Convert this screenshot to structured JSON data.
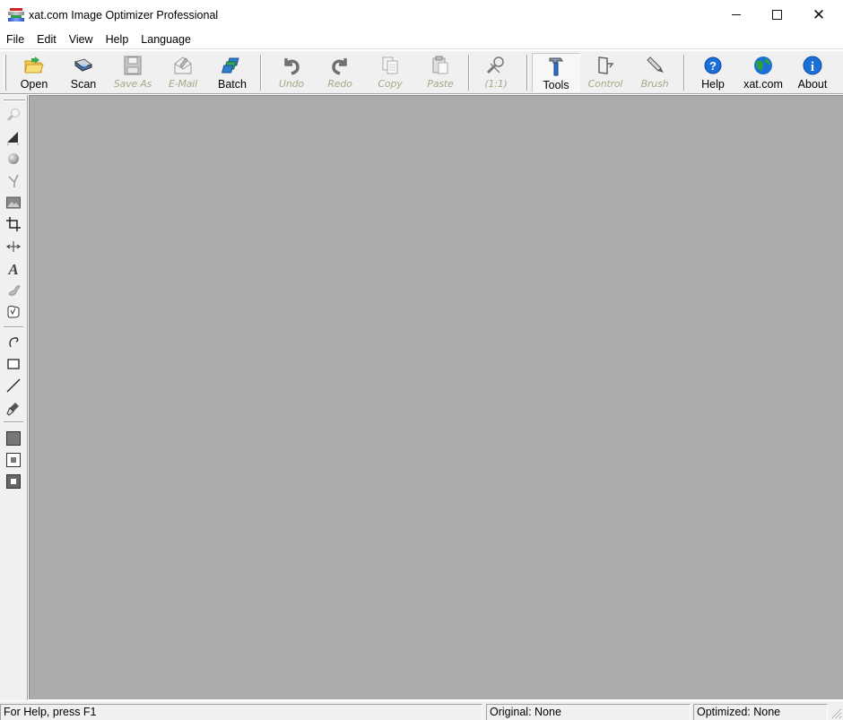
{
  "window": {
    "title": "xat.com  Image Optimizer Professional",
    "app_icon": "xat-app-icon",
    "controls": {
      "minimize": "minimize-icon",
      "maximize": "maximize-icon",
      "close": "close-icon"
    }
  },
  "menubar": {
    "items": [
      {
        "label": "File"
      },
      {
        "label": "Edit"
      },
      {
        "label": "View"
      },
      {
        "label": "Help"
      },
      {
        "label": "Language"
      }
    ]
  },
  "toolbar": {
    "buttons": [
      {
        "label": "Open",
        "icon": "folder-open-icon",
        "enabled": true
      },
      {
        "label": "Scan",
        "icon": "scanner-icon",
        "enabled": true
      },
      {
        "label": "Save As",
        "icon": "floppy-disk-icon",
        "enabled": false
      },
      {
        "label": "E-Mail",
        "icon": "envelope-icon",
        "enabled": false
      },
      {
        "label": "Batch",
        "icon": "batch-stack-icon",
        "enabled": true
      },
      {
        "label": "Undo",
        "icon": "undo-arrow-icon",
        "enabled": false
      },
      {
        "label": "Redo",
        "icon": "redo-arrow-icon",
        "enabled": false
      },
      {
        "label": "Copy",
        "icon": "copy-icon",
        "enabled": false
      },
      {
        "label": "Paste",
        "icon": "paste-icon",
        "enabled": false
      },
      {
        "label": "(1:1)",
        "icon": "zoom-actual-size-icon",
        "enabled": false
      },
      {
        "label": "Tools",
        "icon": "hammer-icon",
        "enabled": true,
        "active": true
      },
      {
        "label": "Control",
        "icon": "control-panel-icon",
        "enabled": false
      },
      {
        "label": "Brush",
        "icon": "brush-icon",
        "enabled": false
      },
      {
        "label": "Help",
        "icon": "help-question-icon",
        "enabled": true
      },
      {
        "label": "xat.com",
        "icon": "globe-icon",
        "enabled": true
      },
      {
        "label": "About",
        "icon": "info-icon",
        "enabled": true
      }
    ]
  },
  "palette": {
    "tools": [
      {
        "name": "zoom-tool",
        "icon": "magnifier-icon"
      },
      {
        "name": "levels-tool",
        "icon": "histogram-icon"
      },
      {
        "name": "sphere-tool",
        "icon": "sphere-icon"
      },
      {
        "name": "curve-tool",
        "icon": "curve-branch-icon"
      },
      {
        "name": "image-tool",
        "icon": "landscape-image-icon"
      },
      {
        "name": "crop-tool",
        "icon": "crop-icon"
      },
      {
        "name": "resize-tool",
        "icon": "resize-arrows-icon"
      },
      {
        "name": "text-tool",
        "icon": "text-a-icon"
      },
      {
        "name": "effects-tool",
        "icon": "effects-icon"
      },
      {
        "name": "region-tool",
        "icon": "region-icon"
      },
      {
        "name": "lasso-tool",
        "icon": "lasso-icon"
      },
      {
        "name": "rectangle-tool",
        "icon": "rectangle-icon"
      },
      {
        "name": "line-tool",
        "icon": "line-icon"
      },
      {
        "name": "paint-brush-tool",
        "icon": "paint-brush-icon"
      },
      {
        "name": "fill-solid",
        "icon": "solid-fill-icon"
      },
      {
        "name": "fill-outline-inner",
        "icon": "outline-fill-icon"
      },
      {
        "name": "fill-inverse-inner",
        "icon": "inverse-fill-icon"
      }
    ]
  },
  "statusbar": {
    "help_text": "For Help, press F1",
    "original": "Original: None",
    "optimized": "Optimized: None"
  },
  "colors": {
    "canvas_bg": "#ababab",
    "chrome_bg": "#f0f0f0",
    "disabled_label": "#a8a888",
    "help_blue": "#1a6fd8",
    "globe_green": "#2a9a3a"
  }
}
